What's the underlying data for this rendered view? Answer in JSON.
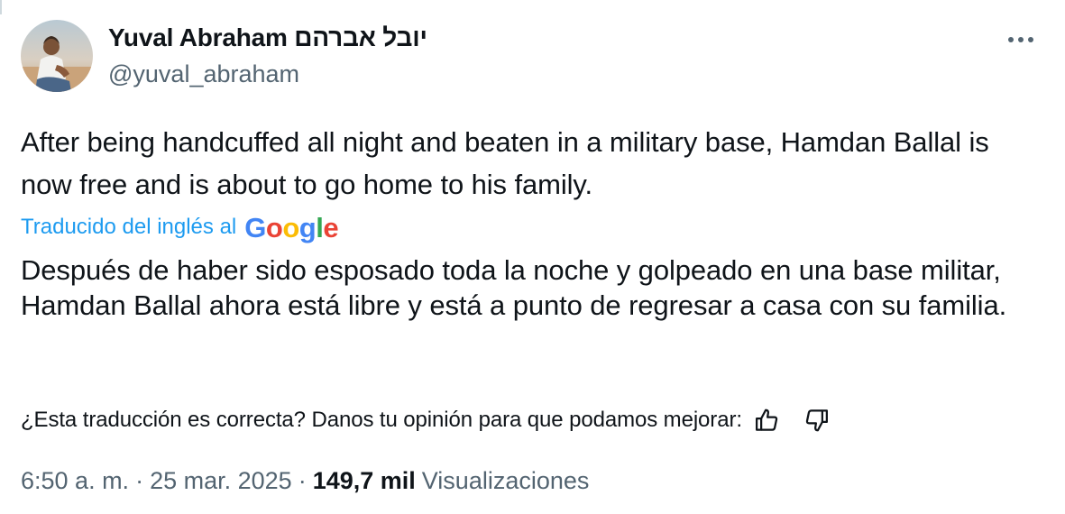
{
  "author": {
    "display_name": "Yuval Abraham יובל אברהם",
    "handle": "@yuval_abraham"
  },
  "menu": {
    "more_icon": "ellipsis-horizontal-icon"
  },
  "tweet": {
    "text": "After being handcuffed all night and beaten in a military base, Hamdan Ballal is now free and is about to go home to his family."
  },
  "translation": {
    "label": "Traducido del inglés al",
    "provider": "Google",
    "text": "Después de haber sido esposado toda la noche y golpeado en una base militar, Hamdan Ballal ahora está libre y está a punto de regresar a casa con su familia.",
    "feedback_prompt": "¿Esta traducción es correcta? Danos tu opinión para que podamos mejorar:",
    "thumbs_up_icon": "thumbs-up-icon",
    "thumbs_down_icon": "thumbs-down-icon"
  },
  "meta": {
    "time": "6:50 a. m.",
    "separator": "·",
    "date": "25 mar. 2025",
    "views_count": "149,7 mil",
    "views_label": "Visualizaciones"
  },
  "colors": {
    "text": "#0f1419",
    "secondary": "#536471",
    "link": "#1d9bf0",
    "google_blue": "#4285f4",
    "google_red": "#ea4335",
    "google_yellow": "#fbbc05",
    "google_green": "#34a853"
  }
}
